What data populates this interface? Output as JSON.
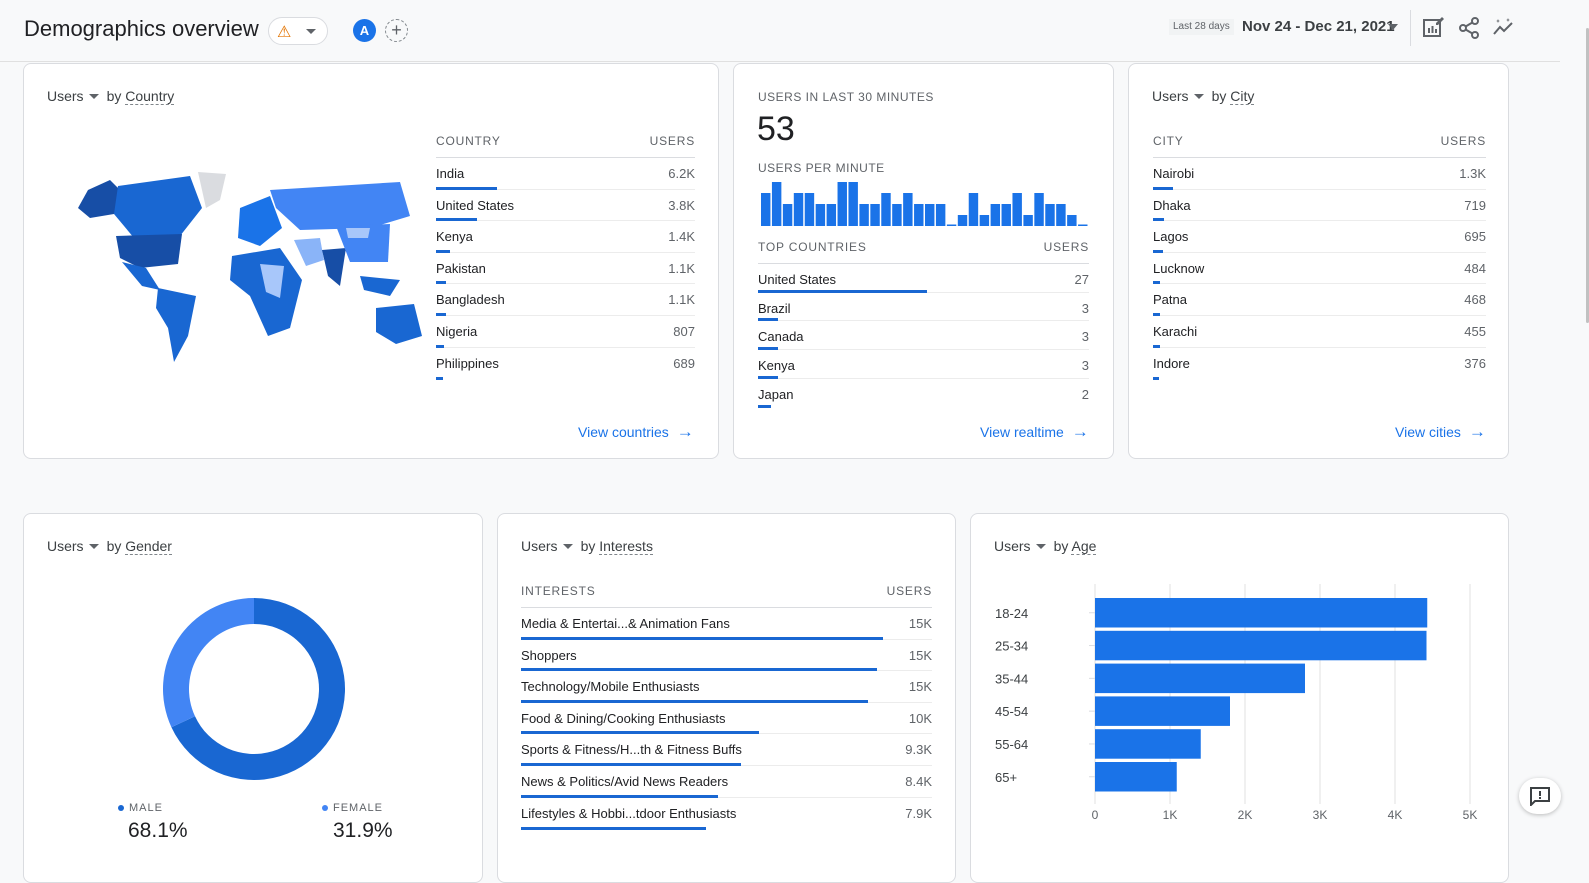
{
  "header": {
    "title": "Demographics overview",
    "warning_icon": "warning-triangle-icon",
    "avatar_letter": "A",
    "add_comparison_icon": "plus-icon",
    "date_range_tag": "Last 28 days",
    "date_range": "Nov 24 - Dec 21, 2021",
    "icons": [
      "edit-report-icon",
      "share-icon",
      "insights-icon"
    ]
  },
  "country_card": {
    "metric": "Users",
    "by": "by",
    "dimension": "Country",
    "col_name": "COUNTRY",
    "col_value": "USERS",
    "rows": [
      {
        "name": "India",
        "value": "6.2K",
        "share": 0.36
      },
      {
        "name": "United States",
        "value": "3.8K",
        "share": 0.24
      },
      {
        "name": "Kenya",
        "value": "1.4K",
        "share": 0.08
      },
      {
        "name": "Pakistan",
        "value": "1.1K",
        "share": 0.06
      },
      {
        "name": "Bangladesh",
        "value": "1.1K",
        "share": 0.06
      },
      {
        "name": "Nigeria",
        "value": "807",
        "share": 0.045
      },
      {
        "name": "Philippines",
        "value": "689",
        "share": 0.04
      }
    ],
    "link": "View countries"
  },
  "realtime_card": {
    "label": "USERS IN LAST 30 MINUTES",
    "count": "53",
    "per_minute_label": "USERS PER MINUTE",
    "per_minute_relative": [
      3,
      4,
      2,
      3,
      3,
      2,
      2,
      4,
      4,
      2,
      2,
      3,
      2,
      3,
      2,
      2,
      2,
      0,
      1,
      3,
      1,
      2,
      2,
      3,
      1,
      3,
      2,
      2,
      1,
      0
    ],
    "per_minute_note": "Bar heights estimated visually from the sparkline; relative shape only, not exact user counts",
    "col_name": "TOP COUNTRIES",
    "col_value": "USERS",
    "rows": [
      {
        "name": "United States",
        "value": "27",
        "share": 0.51
      },
      {
        "name": "Brazil",
        "value": "3",
        "share": 0.06
      },
      {
        "name": "Canada",
        "value": "3",
        "share": 0.06
      },
      {
        "name": "Kenya",
        "value": "3",
        "share": 0.06
      },
      {
        "name": "Japan",
        "value": "2",
        "share": 0.04
      }
    ],
    "link": "View realtime"
  },
  "city_card": {
    "metric": "Users",
    "by": "by",
    "dimension": "City",
    "col_name": "CITY",
    "col_value": "USERS",
    "rows": [
      {
        "name": "Nairobi",
        "value": "1.3K",
        "share": 0.06
      },
      {
        "name": "Dhaka",
        "value": "719",
        "share": 0.032
      },
      {
        "name": "Lagos",
        "value": "695",
        "share": 0.031
      },
      {
        "name": "Lucknow",
        "value": "484",
        "share": 0.022
      },
      {
        "name": "Patna",
        "value": "468",
        "share": 0.021
      },
      {
        "name": "Karachi",
        "value": "455",
        "share": 0.02
      },
      {
        "name": "Indore",
        "value": "376",
        "share": 0.017
      }
    ],
    "link": "View cities"
  },
  "gender_card": {
    "metric": "Users",
    "by": "by",
    "dimension": "Gender",
    "segments": [
      {
        "label": "MALE",
        "value": "68.1%",
        "fraction": 0.681,
        "color": "#1967d2"
      },
      {
        "label": "FEMALE",
        "value": "31.9%",
        "fraction": 0.319,
        "color": "#4285f4"
      }
    ]
  },
  "interests_card": {
    "metric": "Users",
    "by": "by",
    "dimension": "Interests",
    "col_name": "INTERESTS",
    "col_value": "USERS",
    "rows": [
      {
        "name": "Media & Entertai...& Animation Fans",
        "value": "15K",
        "share": 0.88
      },
      {
        "name": "Shoppers",
        "value": "15K",
        "share": 0.865
      },
      {
        "name": "Technology/Mobile Enthusiasts",
        "value": "15K",
        "share": 0.845
      },
      {
        "name": "Food & Dining/Cooking Enthusiasts",
        "value": "10K",
        "share": 0.58
      },
      {
        "name": "Sports & Fitness/H...th & Fitness Buffs",
        "value": "9.3K",
        "share": 0.535
      },
      {
        "name": "News & Politics/Avid News Readers",
        "value": "8.4K",
        "share": 0.48
      },
      {
        "name": "Lifestyles & Hobbi...tdoor Enthusiasts",
        "value": "7.9K",
        "share": 0.45
      }
    ]
  },
  "age_card": {
    "metric": "Users",
    "by": "by",
    "dimension": "Age"
  },
  "colors": {
    "accent": "#1a73e8",
    "bar": "#1967d2",
    "age_bar": "#1a73e8",
    "warning": "#e37400"
  },
  "chart_data": [
    {
      "type": "bar",
      "orientation": "horizontal",
      "title": "Users by Age",
      "categories": [
        "18-24",
        "25-34",
        "35-44",
        "45-54",
        "55-64",
        "65+"
      ],
      "values": [
        4430,
        4420,
        2800,
        1800,
        1410,
        1090
      ],
      "xlabel": "",
      "ylabel": "",
      "xlim": [
        0,
        5000
      ],
      "xticks": [
        "0",
        "1K",
        "2K",
        "3K",
        "4K",
        "5K"
      ],
      "grid": true
    },
    {
      "type": "pie",
      "title": "Users by Gender",
      "categories": [
        "MALE",
        "FEMALE"
      ],
      "values": [
        68.1,
        31.9
      ]
    },
    {
      "type": "bar",
      "title": "Users per minute",
      "note": "Relative bar heights estimated from the sparkline; no axis or values are printed",
      "values": [
        3,
        4,
        2,
        3,
        3,
        2,
        2,
        4,
        4,
        2,
        2,
        3,
        2,
        3,
        2,
        2,
        2,
        0,
        1,
        3,
        1,
        2,
        2,
        3,
        1,
        3,
        2,
        2,
        1,
        0
      ]
    }
  ]
}
